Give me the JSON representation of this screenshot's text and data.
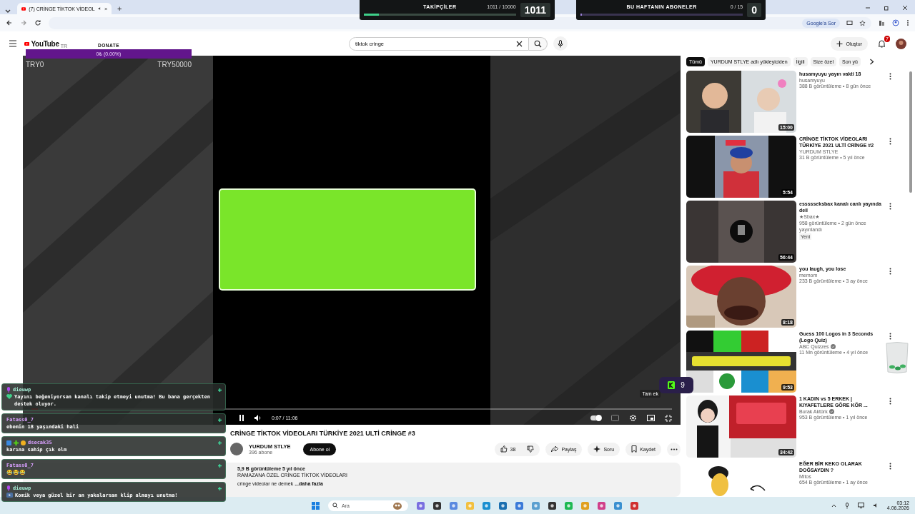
{
  "browser": {
    "tab": {
      "title": "(7) CRİNGE TİKTOK VİDEOL",
      "playing": true
    },
    "new_tab": "+",
    "ask_google": "Google'a Sor"
  },
  "widgets": [
    {
      "title": "TAKİPÇİLER",
      "reading": "1011 / 10000",
      "count": "1011",
      "level": 0.1011
    },
    {
      "title": "BU HAFTANIN ABONELER",
      "reading": "0 / 15",
      "count": "0",
      "level": 0
    }
  ],
  "donate": {
    "title": "DONATE",
    "progress": "0₺ (0.00%)",
    "level": 0,
    "min": "TRY0",
    "max": "TRY50000"
  },
  "youtube": {
    "logo": "YouTube",
    "region": "TR",
    "search": {
      "value": "tiktok cringe"
    },
    "create": "Oluştur",
    "notifications": "7"
  },
  "player": {
    "time": "0:07 / 11:06",
    "playing": true,
    "level": 0.0105,
    "tooltip": "Tam ek",
    "autoplay": true
  },
  "video": {
    "title": "CRİNGE TİKTOK VİDEOLARI TÜRKİYE 2021 ULTİ CRİNGE #3",
    "channel": "YURDUM STLYE",
    "subscribers": "396 abone",
    "subscribe": "Abone ol",
    "likes": "38",
    "actions": [
      "Paylaş",
      "Soru",
      "Kaydet"
    ],
    "description": {
      "stats": "5,9 B görüntüleme  5 yıl önce",
      "line": "RAMAZANA ÖZEL CRİNGE TİKTOK VİDEOLARI",
      "snippet": "cringe videolar ne demek",
      "more": "...daha fazla"
    }
  },
  "chips": [
    {
      "label": "Tümü",
      "selected": true
    },
    {
      "label": "YURDUM STLYE adlı yükleyiciden",
      "selected": false
    },
    {
      "label": "İlgili",
      "selected": false
    },
    {
      "label": "Size özel",
      "selected": false
    },
    {
      "label": "Son yü",
      "selected": false
    }
  ],
  "recommendations": [
    {
      "title": "husamyuyu yayın vakti 18",
      "channel": "husamyuyu",
      "meta": "388 B görüntüleme • 8 gün önce",
      "duration": "15:00",
      "verified": false
    },
    {
      "title": "CRİNGE TİKTOK VİDEOLARI TÜRKİYE 2021 ULTİ CRİNGE #2",
      "channel": "YURDUM STLYE",
      "meta": "31 B görüntüleme • 5 yıl önce",
      "duration": "5:54",
      "verified": false
    },
    {
      "title": "essssseksbax kanalı canlı yayında deil",
      "channel": "★Sbax★",
      "meta": "958 görüntüleme • 2 gün önce yayınlandı",
      "badge": "Yeni",
      "duration": "56:44",
      "verified": false
    },
    {
      "title": "you laugh, you lose",
      "channel": "memom",
      "meta": "233 B görüntüleme • 3 ay önce",
      "duration": "8:18",
      "verified": false
    },
    {
      "title": "Guess 100 Logos in 3 Seconds (Logo Quiz)",
      "channel": "ABC Quizzes",
      "meta": "11 Mn görüntüleme • 4 yıl önce",
      "duration": "9:53",
      "verified": true
    },
    {
      "title": "1 KADIN vs 5 ERKEK | KIYAFETLERE GÖRE KÖR ...",
      "channel": "Burak Aktürk",
      "meta": "953 B görüntüleme • 1 yıl önce",
      "duration": "34:42",
      "verified": true
    },
    {
      "title": "EĞER BİR KEKO OLARAK DOĞSAYDIN ?",
      "channel": "Mitos",
      "meta": "654 B görüntüleme • 1 ay önce",
      "verified": false
    }
  ],
  "chat": [
    {
      "kind": "follow-reminder",
      "user": "dieuwp",
      "color": "#a8f0d8",
      "text": "Yayını beğeniyorsan kanalı takip etmeyi unutma! Bu bana gerçekten destek oluyor."
    },
    {
      "kind": "plain",
      "user": "Fatass0_7",
      "color": "#d9a0ff",
      "text": "ebemin 18 yaşındaki hali"
    },
    {
      "kind": "badged",
      "user": "dsecak35",
      "color": "#d9a0ff",
      "text": "karına sahip çık olm"
    },
    {
      "kind": "plain",
      "user": "Fatass0_7",
      "color": "#d9a0ff",
      "text": "😂😂😂"
    },
    {
      "kind": "clip-reminder",
      "user": "dieuwp",
      "color": "#a8f0d8",
      "text": "Komik veya güzel bir an yakalarsan klip almayı unutma!"
    }
  ],
  "kick": {
    "count": "9"
  },
  "taskbar": {
    "search": "Ara",
    "time": "03:12",
    "date": "4.06.2026"
  }
}
